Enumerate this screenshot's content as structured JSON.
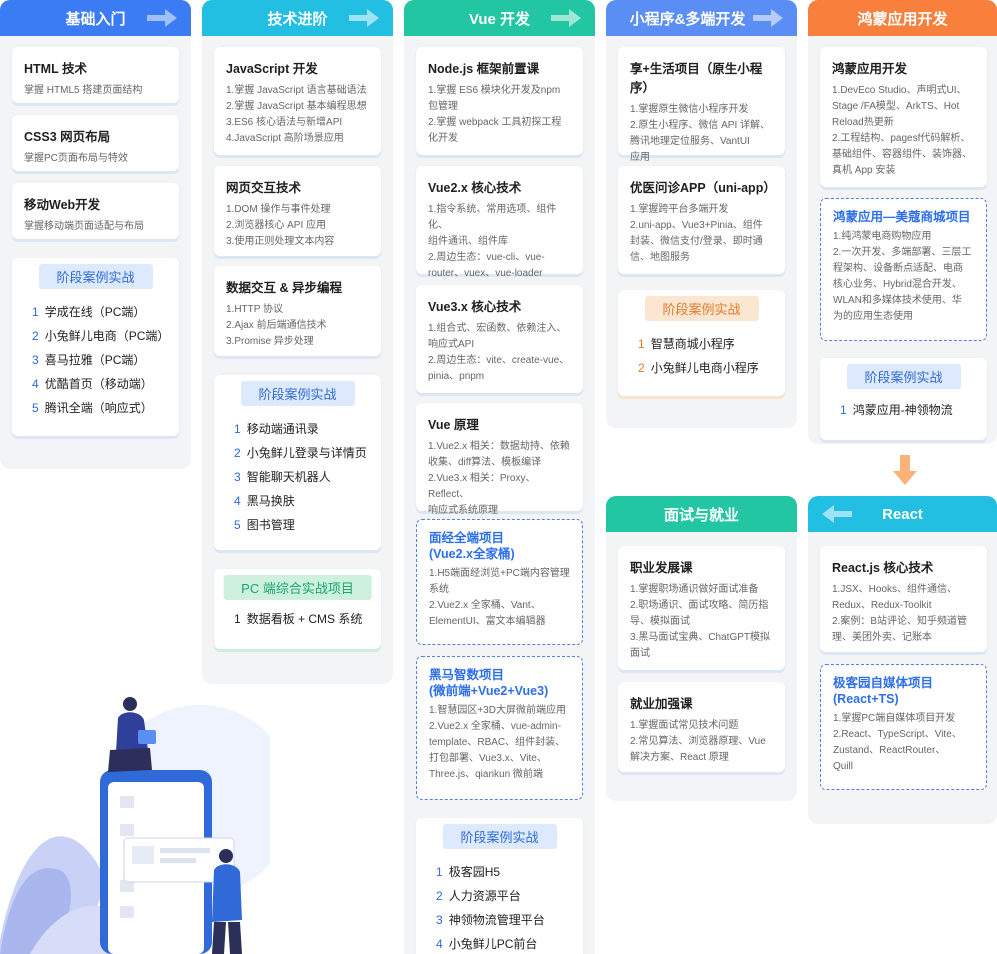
{
  "columns": [
    {
      "title": "基础入门",
      "color": "#3b7cf5"
    },
    {
      "title": "技术进阶",
      "color": "#22bfe3"
    },
    {
      "title": "Vue 开发",
      "color": "#23c6a3"
    },
    {
      "title": "小程序&多端开发",
      "color": "#5b8ef5"
    },
    {
      "title": "鸿蒙应用开发",
      "color": "#f97f3c"
    },
    {
      "title": "面试与就业",
      "color": "#23c6a3"
    },
    {
      "title": "React",
      "color": "#22bfe3"
    }
  ],
  "col1": {
    "cards": [
      {
        "title": "HTML 技术",
        "lines": [
          "掌握 HTML5 搭建页面结构"
        ]
      },
      {
        "title": "CSS3 网页布局",
        "lines": [
          "掌握PC页面布局与特效"
        ]
      },
      {
        "title": "移动Web开发",
        "lines": [
          "掌握移动端页面适配与布局"
        ]
      }
    ],
    "case_title": "阶段案例实战",
    "cases": [
      "学成在线（PC端）",
      "小兔鲜儿电商（PC端）",
      "喜马拉雅（PC端）",
      "优酷首页（移动端）",
      "腾讯全端（响应式）"
    ]
  },
  "col2": {
    "cards": [
      {
        "title": "JavaScript 开发",
        "lines": [
          "1.掌握 JavaScript 语言基础语法",
          "2.掌握 JavaScript 基本编程思想",
          "3.ES6 核心语法与新增API",
          "4.JavaScript 高阶场景应用"
        ]
      },
      {
        "title": "网页交互技术",
        "lines": [
          "1.DOM 操作与事件处理",
          "2.浏览器核心 API 应用",
          "3.使用正则处理文本内容"
        ]
      },
      {
        "title": "数据交互 & 异步编程",
        "lines": [
          "1.HTTP 协议",
          "2.Ajax 前后端通信技术",
          "3.Promise 异步处理"
        ]
      }
    ],
    "case_title": "阶段案例实战",
    "cases": [
      "移动端通讯录",
      "小兔鲜儿登录与详情页",
      "智能聊天机器人",
      "黑马换肤",
      "图书管理"
    ],
    "pc_title": "PC 端综合实战项目",
    "pc_cases": [
      "数据看板 + CMS 系统"
    ]
  },
  "col3": {
    "cards": [
      {
        "title": "Node.js 框架前置课",
        "lines": [
          "1.掌握 ES6 模块化开发及npm",
          "  包管理",
          "2.掌握 webpack 工具初探工程",
          "  化开发"
        ]
      },
      {
        "title": "Vue2.x 核心技术",
        "lines": [
          "1.指令系统、常用选项、组件化、",
          "  组件通讯、组件库",
          "2.周边生态：vue-cli、vue-",
          "  router、vuex、vue-loader"
        ]
      },
      {
        "title": "Vue3.x 核心技术",
        "lines": [
          "1.组合式、宏函数、依赖注入、",
          "  响应式API",
          "2.周边生态：vite、create-vue、",
          "  pinia、pnpm"
        ]
      },
      {
        "title": "Vue 原理",
        "lines": [
          "1.Vue2.x 相关：数据劫持、依赖",
          "  收集、diff算法、模板编译",
          "2.Vue3.x 相关：Proxy、Reflect、",
          "  响应式系统原理"
        ]
      }
    ],
    "projects": [
      {
        "title_lines": [
          "面经全端项目",
          "(Vue2.x全家桶)"
        ],
        "lines": [
          "1.H5端面经浏览+PC端内容管理",
          "  系统",
          "2.Vue2.x 全家桶、Vant、",
          "  ElementUI、富文本编辑器"
        ]
      },
      {
        "title_lines": [
          "黑马智数项目",
          "(微前端+Vue2+Vue3)"
        ],
        "lines": [
          "1.智慧园区+3D大屏微前端应用",
          "2.Vue2.x 全家桶、vue-admin-",
          "  template、RBAC、组件封装、",
          "  打包部署、Vue3.x、Vite、",
          "  Three.js、qiankun 微前端"
        ]
      }
    ],
    "case_title": "阶段案例实战",
    "cases": [
      "极客园H5",
      "人力资源平台",
      "神领物流管理平台",
      "小兔鲜儿PC前台"
    ]
  },
  "col4": {
    "cards": [
      {
        "title": "享+生活项目（原生小程序）",
        "lines": [
          "1.掌握原生微信小程序开发",
          "2.原生小程序、微信 API 详解、",
          "  腾讯地理定位服务、VantUI",
          "  应用"
        ]
      },
      {
        "title": "优医问诊APP（uni-app）",
        "lines": [
          "1.掌握跨平台多端开发",
          "2.uni-app、Vue3+Pinia、组件",
          "  封装、微信支付/登录、即时通",
          "  信、地图服务"
        ]
      }
    ],
    "case_title": "阶段案例实战",
    "cases": [
      "智慧商城小程序",
      "小兔鲜儿电商小程序"
    ]
  },
  "col5": {
    "cards": [
      {
        "title": "鸿蒙应用开发",
        "lines": [
          "1.DevEco Studio、声明式UI、",
          "  Stage /FA模型、ArkTS、Hot",
          "  Reload热更新",
          "2.工程结构、pagesf代码解析、",
          "  基础组件、容器组件、装饰器、",
          "  真机 App 安装"
        ]
      }
    ],
    "project": {
      "title_lines": [
        "鸿蒙应用—美蔻商城项目"
      ],
      "lines": [
        "1.纯鸿蒙电商购物应用",
        "2.一次开发、多端部署、三层工",
        "  程架构、设备断点适配、电商",
        "  核心业务、Hybrid混合开发、",
        "  WLAN和多媒体技术使用、华",
        "  为的应用生态使用"
      ]
    },
    "case_title": "阶段案例实战",
    "cases": [
      "鸿蒙应用-神领物流"
    ]
  },
  "col6": {
    "cards": [
      {
        "title": "职业发展课",
        "lines": [
          "1.掌握职场通识做好面试准备",
          "2.职场通识、面试攻略、简历指",
          "  导、模拟面试",
          "3.黑马面试宝典、ChatGPT模拟",
          "  面试"
        ]
      },
      {
        "title": "就业加强课",
        "lines": [
          "1.掌握面试常见技术问题",
          "2.常见算法、浏览器原理、Vue",
          "  解决方案、React 原理"
        ]
      }
    ]
  },
  "col7": {
    "cards": [
      {
        "title": "React.js 核心技术",
        "lines": [
          "1.JSX、Hooks、组件通信、",
          "  Redux、Redux-Toolkit",
          "2.案例：B站评论、知乎频道管",
          "  理、美团外卖、记账本"
        ]
      }
    ],
    "project": {
      "title_lines": [
        "极客园自媒体项目",
        "(React+TS)"
      ],
      "lines": [
        "1.掌握PC端自媒体项目开发",
        "2.React、TypeScript、Vite、",
        "  Zustand、ReactRouter、",
        "  Quill"
      ]
    }
  }
}
